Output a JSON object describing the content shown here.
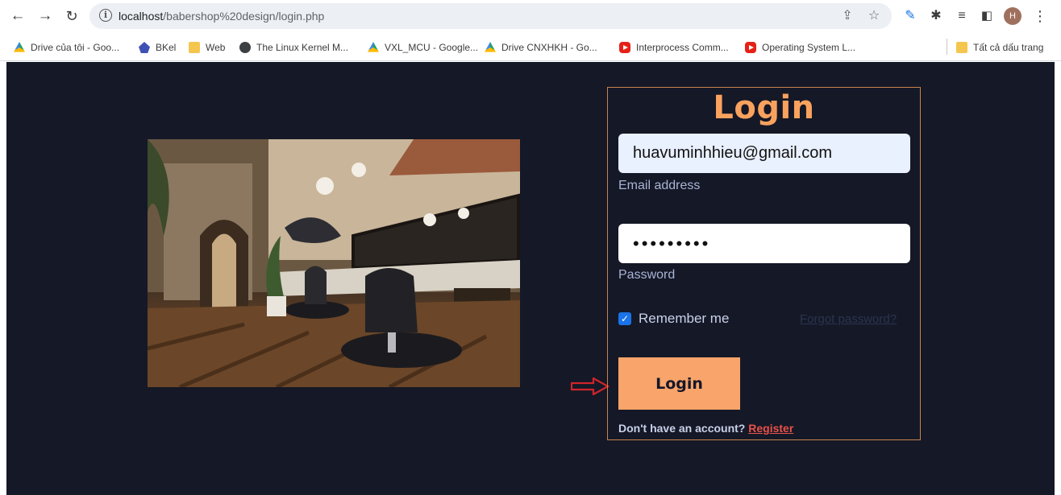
{
  "browser": {
    "url_host": "localhost",
    "url_path": "/babershop%20design/login.php",
    "profile_initial": "H",
    "bookmarks": [
      {
        "label": "Drive của tôi - Goo...",
        "icon": "google-drive-icon"
      },
      {
        "label": "BKel",
        "icon": "bkel-icon"
      },
      {
        "label": "Web",
        "icon": "folder-icon"
      },
      {
        "label": "The Linux Kernel M...",
        "icon": "globe-icon"
      },
      {
        "label": "VXL_MCU - Google...",
        "icon": "google-drive-icon"
      },
      {
        "label": "Drive CNXHKH - Go...",
        "icon": "google-drive-icon"
      },
      {
        "label": "Interprocess Comm...",
        "icon": "youtube-icon"
      },
      {
        "label": "Operating System L...",
        "icon": "youtube-icon"
      }
    ],
    "all_bookmarks_label": "Tất cả dấu trang"
  },
  "login": {
    "title": "Login",
    "email_value": "huavuminhhieu@gmail.com",
    "email_label": "Email address",
    "password_value": "•••••••••",
    "password_label": "Password",
    "remember_label": "Remember me",
    "remember_checked": true,
    "forgot_label": "Forgot password?",
    "button_label": "Login",
    "no_account_text": "Don't have an account?",
    "register_label": "Register"
  },
  "colors": {
    "page_background": "#151826",
    "accent_orange": "#f9a25e",
    "border": "#c9834f",
    "register_link": "#e8514a",
    "annotation_arrow": "#d0242a"
  }
}
